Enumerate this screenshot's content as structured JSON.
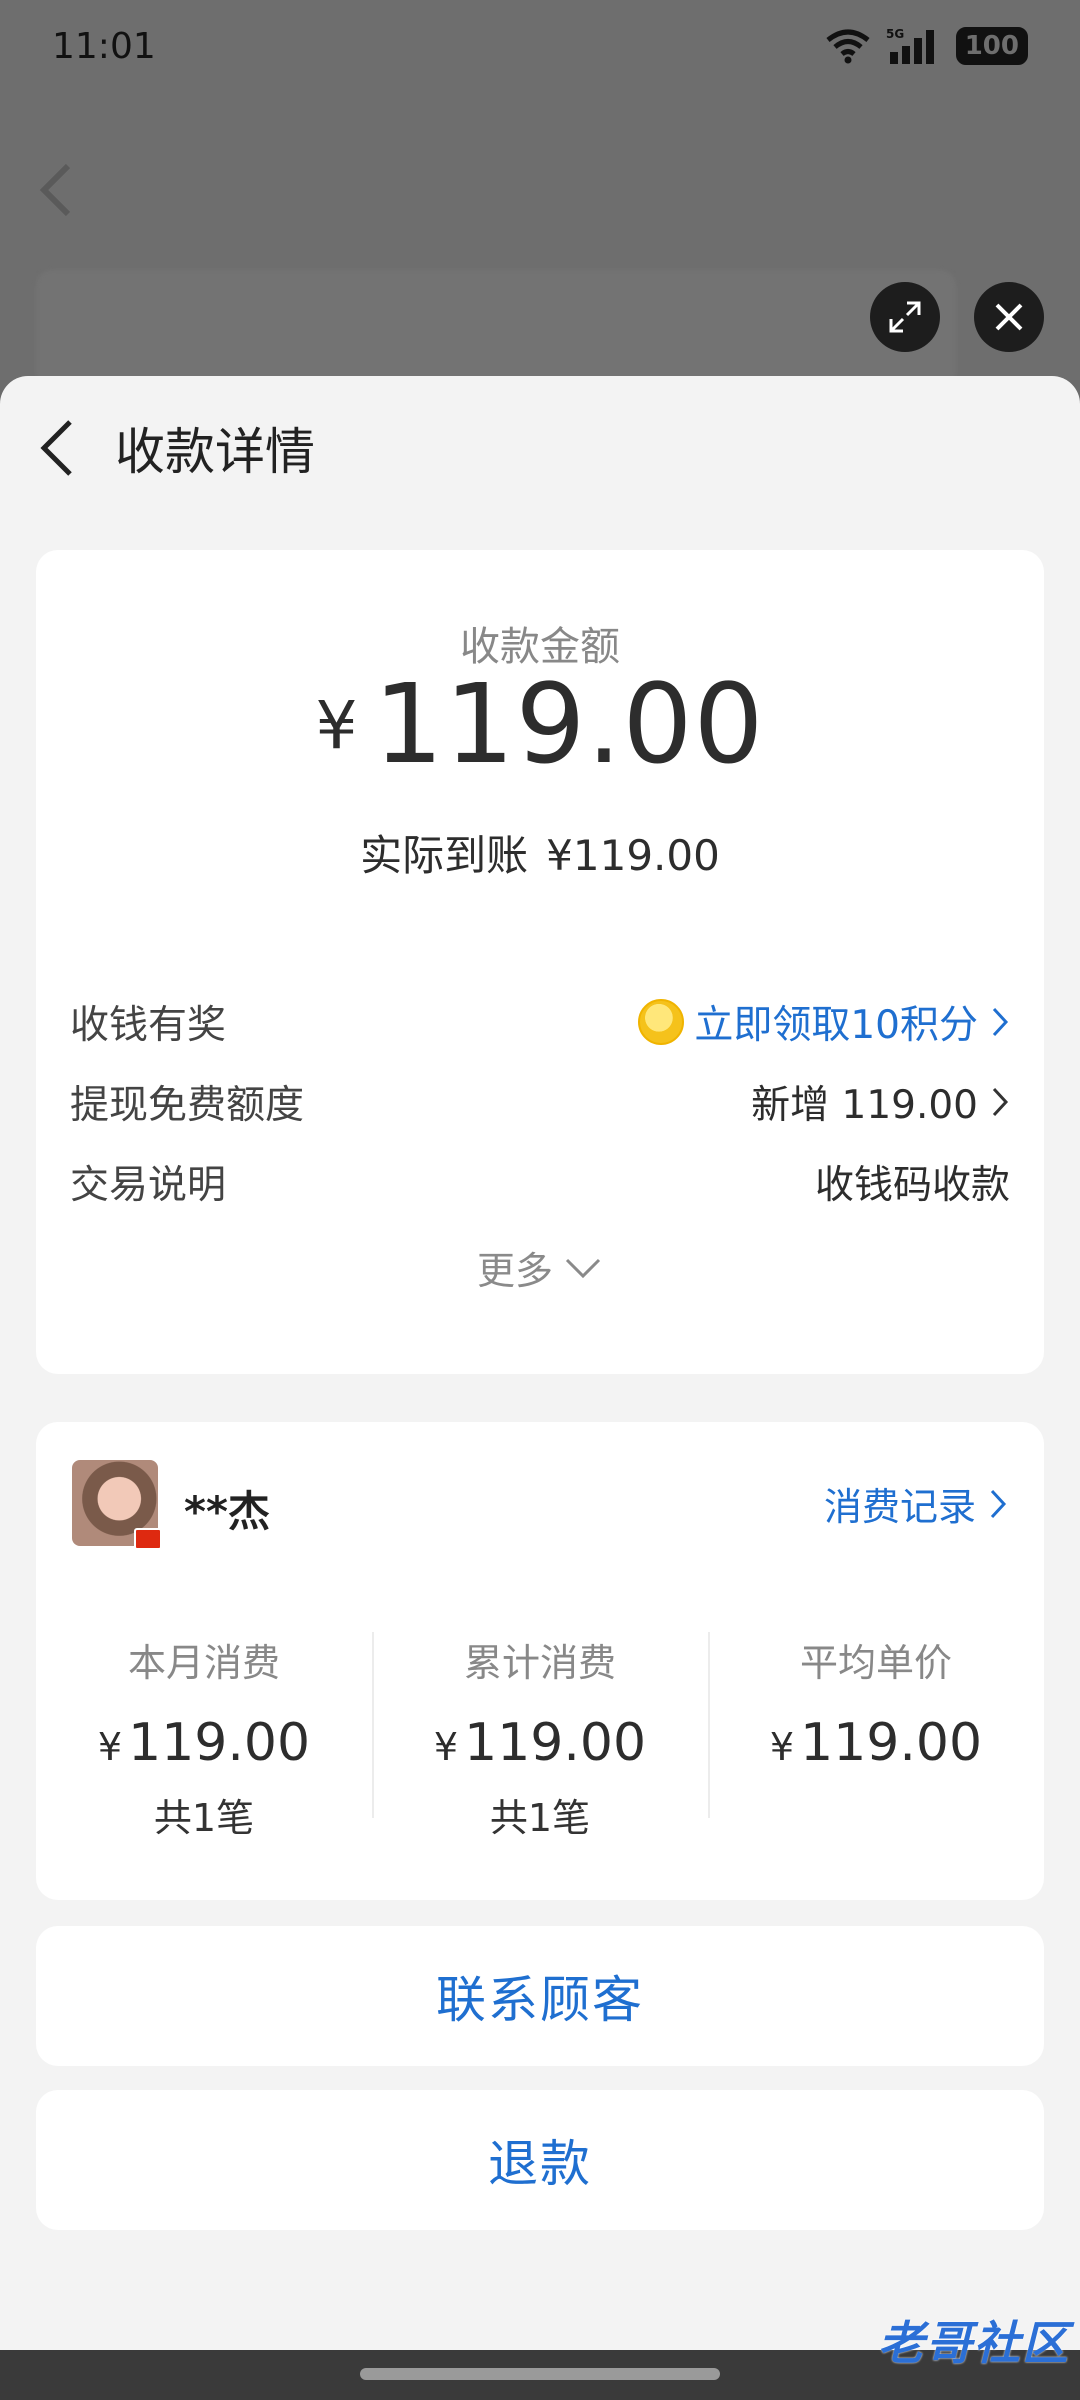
{
  "status_bar": {
    "time": "11:01",
    "network": "5G",
    "battery": "100"
  },
  "sheet": {
    "title": "收款详情"
  },
  "amount_card": {
    "label": "收款金额",
    "currency": "¥",
    "amount": "119.00",
    "actual_label": "实际到账",
    "actual_value": "¥119.00",
    "rows": [
      {
        "key": "收钱有奖",
        "value": "立即领取10积分"
      },
      {
        "key": "提现免费额度",
        "value": "新增 119.00"
      },
      {
        "key": "交易说明",
        "value": "收钱码收款"
      }
    ],
    "more": "更多"
  },
  "customer_card": {
    "name": "**杰",
    "link": "消费记录",
    "stats": [
      {
        "title": "本月消费",
        "currency": "¥",
        "amount": "119.00",
        "count": "共1笔"
      },
      {
        "title": "累计消费",
        "currency": "¥",
        "amount": "119.00",
        "count": "共1笔"
      },
      {
        "title": "平均单价",
        "currency": "¥",
        "amount": "119.00",
        "count": ""
      }
    ]
  },
  "buttons": {
    "contact": "联系顾客",
    "refund": "退款"
  },
  "watermark": "老哥社区",
  "colors": {
    "accent": "#1f6fd0",
    "sheet_bg": "#f3f3f3",
    "card_bg": "#ffffff"
  }
}
